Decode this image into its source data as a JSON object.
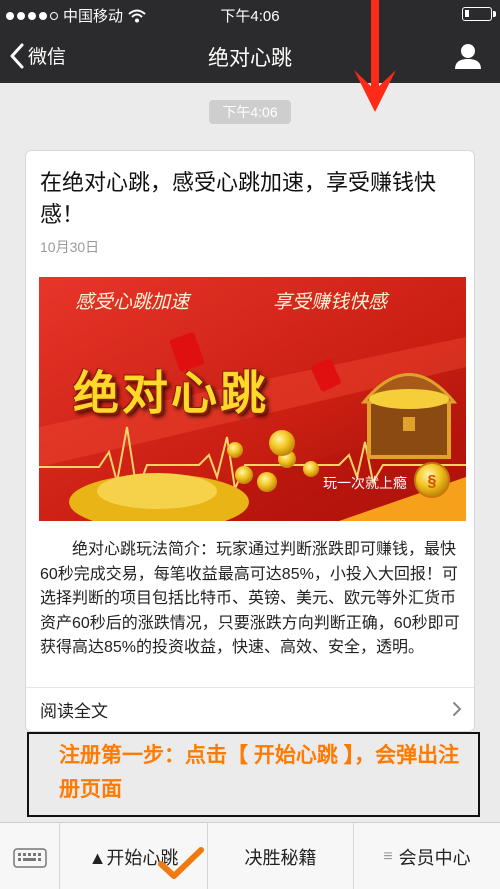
{
  "status": {
    "carrier": "中国移动",
    "time": "下午4:06"
  },
  "nav": {
    "back_label": "微信",
    "title": "绝对心跳"
  },
  "chat": {
    "time_chip": "下午4:06",
    "card": {
      "title": "在绝对心跳，感受心跳加速，享受赚钱快感！",
      "date": "10月30日",
      "banner": {
        "slogan_left": "感受心跳加速",
        "slogan_right": "享受赚钱快感",
        "logo_text": "绝对心跳",
        "tagline": "玩一次就上瘾"
      },
      "body": "绝对心跳玩法简介：玩家通过判断涨跌即可赚钱，最快60秒完成交易，每笔收益最高可达85%，小投入大回报！可选择判断的项目包括比特币、英镑、美元、欧元等外汇货币资产60秒后的涨跌情况，只要涨跌方向判断正确，60秒即可获得高达85%的投资收益，快速、高效、安全，透明。",
      "read_more": "阅读全文"
    }
  },
  "annotation": {
    "text": "注册第一步：点击【 开始心跳 】，会弹出注册页面",
    "color": "#ff7a00"
  },
  "bottom_menu": {
    "items": [
      {
        "label": "▲开始心跳"
      },
      {
        "label": "决胜秘籍"
      },
      {
        "label": "会员中心",
        "prefix_icon": "menu-lines-icon"
      }
    ]
  },
  "colors": {
    "nav_bg": "#2b2b2d",
    "chat_bg": "#ebebeb",
    "banner_red": "#d8261a",
    "gold": "#ffd92a"
  }
}
